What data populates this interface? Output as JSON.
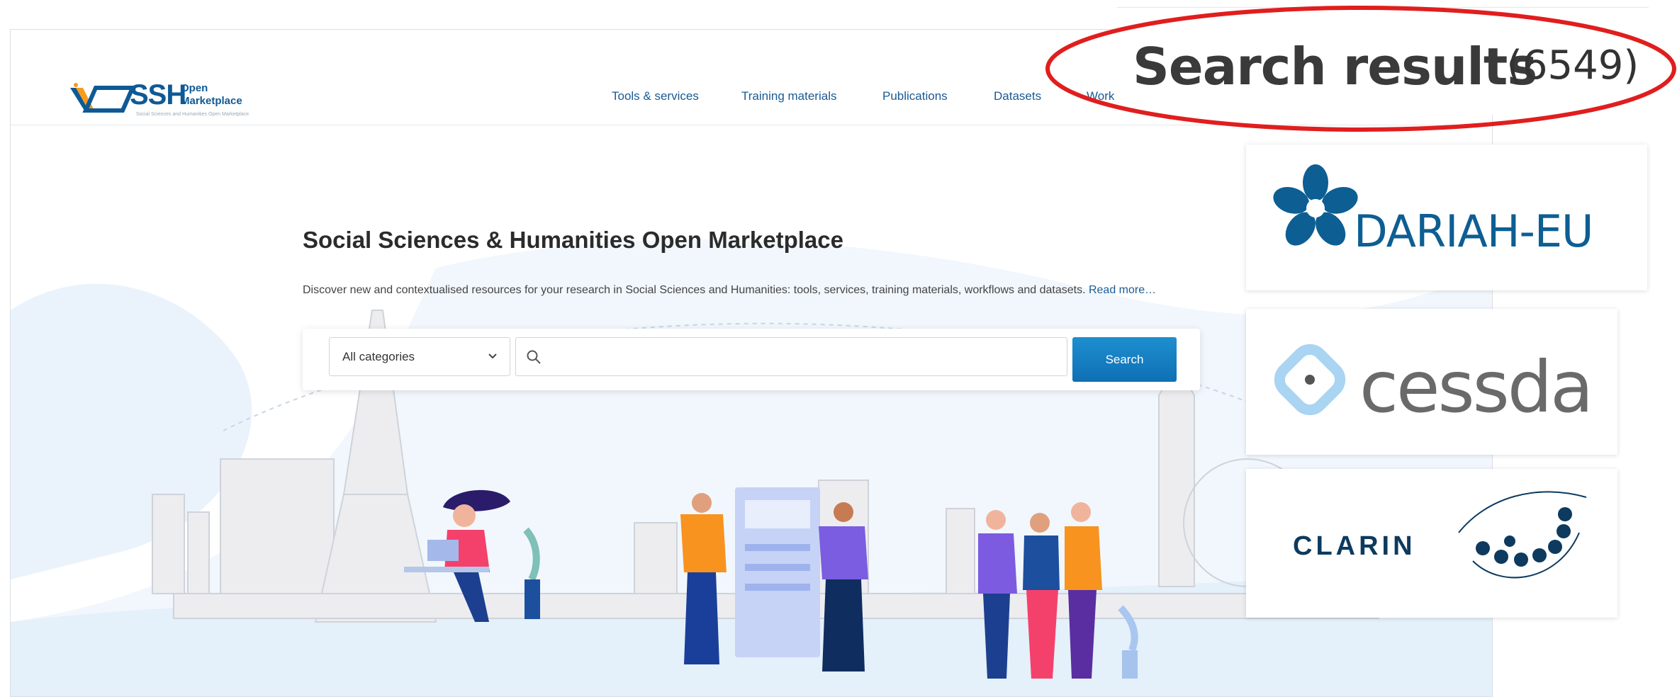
{
  "site": {
    "logo": {
      "title": "SSH",
      "subtitle_line1": "Open",
      "subtitle_line2": "Marketplace",
      "tagline": "Social Sciences and Humanities Open Marketplace"
    },
    "nav": [
      {
        "label": "Tools & services"
      },
      {
        "label": "Training materials"
      },
      {
        "label": "Publications"
      },
      {
        "label": "Datasets"
      },
      {
        "label": "Work"
      }
    ],
    "hero": {
      "title": "Social Sciences & Humanities Open Marketplace",
      "description": "Discover new and contextualised resources for your research in Social Sciences and Humanities: tools, services, training materials, workflows and datasets.",
      "read_more": "Read more…"
    },
    "search": {
      "category_value": "All categories",
      "query_value": "",
      "button_label": "Search"
    }
  },
  "callout": {
    "title": "Search results",
    "count": "(6549)",
    "ellipse_color": "#e01e1e"
  },
  "partners": [
    {
      "name": "DARIAH-EU",
      "color": "#0d5e93",
      "icon": "dariah-flower-icon"
    },
    {
      "name": "cessda",
      "color": "#6a6a6a",
      "icon": "cessda-diamond-icon"
    },
    {
      "name": "CLARIN",
      "color": "#0d3a5e",
      "icon": "clarin-dots-icon"
    }
  ]
}
